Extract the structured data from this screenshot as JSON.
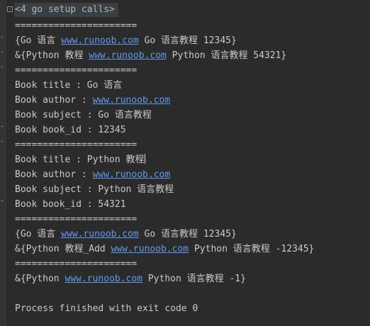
{
  "console": {
    "header": "<4 go setup calls>",
    "fold_glyph": "⊟",
    "link_color": "#5f9be8",
    "lines": [
      {
        "segments": [
          {
            "t": "======================"
          }
        ]
      },
      {
        "segments": [
          {
            "t": "{Go 语言 "
          },
          {
            "t": "www.runoob.com",
            "link": true
          },
          {
            "t": " Go 语言教程 12345}"
          }
        ]
      },
      {
        "segments": [
          {
            "t": "&{Python 教程 "
          },
          {
            "t": "www.runoob.com",
            "link": true
          },
          {
            "t": " Python 语言教程 54321}"
          }
        ]
      },
      {
        "segments": [
          {
            "t": "======================"
          }
        ]
      },
      {
        "segments": [
          {
            "t": "Book title : Go 语言"
          }
        ]
      },
      {
        "segments": [
          {
            "t": "Book author : "
          },
          {
            "t": "www.runoob.com",
            "link": true
          }
        ]
      },
      {
        "segments": [
          {
            "t": "Book subject : Go 语言教程"
          }
        ]
      },
      {
        "segments": [
          {
            "t": "Book book_id : 12345"
          }
        ]
      },
      {
        "segments": [
          {
            "t": "======================"
          }
        ]
      },
      {
        "segments": [
          {
            "t": "Book title : Python 教程"
          }
        ],
        "caret": true
      },
      {
        "segments": [
          {
            "t": "Book author : "
          },
          {
            "t": "www.runoob.com",
            "link": true
          }
        ]
      },
      {
        "segments": [
          {
            "t": "Book subject : Python 语言教程"
          }
        ]
      },
      {
        "segments": [
          {
            "t": "Book book_id : 54321"
          }
        ]
      },
      {
        "segments": [
          {
            "t": "======================"
          }
        ]
      },
      {
        "segments": [
          {
            "t": "{Go 语言 "
          },
          {
            "t": "www.runoob.com",
            "link": true
          },
          {
            "t": " Go 语言教程 12345}"
          }
        ]
      },
      {
        "segments": [
          {
            "t": "&{Python 教程_Add "
          },
          {
            "t": "www.runoob.com",
            "link": true
          },
          {
            "t": " Python 语言教程 -12345}"
          }
        ]
      },
      {
        "segments": [
          {
            "t": "======================"
          }
        ]
      },
      {
        "segments": [
          {
            "t": "&{Python "
          },
          {
            "t": "www.runoob.com",
            "link": true
          },
          {
            "t": " Python 语言教程 -1}"
          }
        ]
      },
      {
        "segments": [
          {
            "t": ""
          }
        ]
      },
      {
        "segments": [
          {
            "t": "Process finished with exit code 0"
          }
        ]
      }
    ]
  }
}
